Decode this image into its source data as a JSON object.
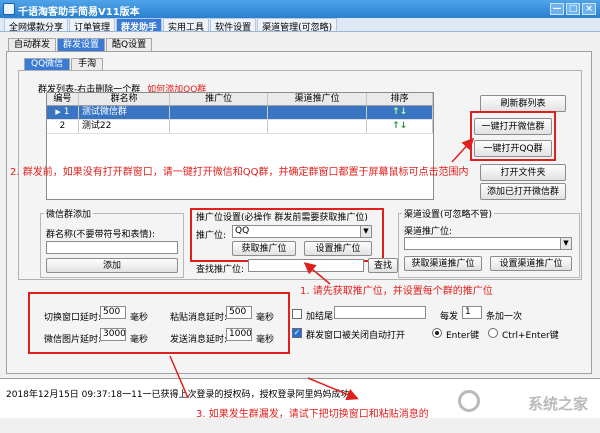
{
  "window": {
    "title": "千语淘客助手简易V11版本",
    "controls": [
      "—",
      "□",
      "×"
    ]
  },
  "menu_tabs": [
    "全网爆款分享",
    "订单管理",
    "群发助手",
    "实用工具",
    "软件设置",
    "渠道管理(可忽略)"
  ],
  "sub_tabs": [
    "自动群发",
    "群发设置",
    "酷Q设置"
  ],
  "sub_tabs2": [
    "QQ微信",
    "手淘"
  ],
  "group_list": {
    "title": "群发列表-右击删除一个群",
    "hint": "如何添加QQ群",
    "columns": [
      "编号",
      "群名称",
      "推广位",
      "渠道推广位",
      "排序"
    ],
    "rows": [
      {
        "marker": "▶",
        "num": "1",
        "name": "测试微信群",
        "pid": "",
        "channel": "",
        "sort": "↑↓"
      },
      {
        "marker": "",
        "num": "2",
        "name": "测试22",
        "pid": "",
        "channel": "",
        "sort": "↑↓"
      }
    ]
  },
  "buttons": {
    "refresh": "刷新群列表",
    "open_wechat": "一键打开微信群",
    "open_qq": "一键打开QQ群",
    "open_folder": "打开文件夹",
    "add_opened_wechat": "添加已打开微信群",
    "add": "添加",
    "get_pid": "获取推广位",
    "set_pid": "设置推广位",
    "search": "查找",
    "get_channel": "获取渠道推广位",
    "set_channel": "设置渠道推广位"
  },
  "wechat_add": {
    "title": "微信群添加",
    "label": "群名称(不要带符号和表情):",
    "value": ""
  },
  "pid_setting": {
    "title": "推广位设置(必操作 群发前需要获取推广位)",
    "label": "推广位:",
    "value": "QQ",
    "search_label": "查找推广位:",
    "search_value": ""
  },
  "channel_setting": {
    "title": "渠道设置(可忽略不管)",
    "label": "渠道推广位:",
    "value": ""
  },
  "delays": {
    "switch_label": "切换窗口延时:",
    "switch_value": "500",
    "paste_label": "粘贴消息延时:",
    "paste_value": "500",
    "image_label": "微信图片延时:",
    "image_value": "3000",
    "send_label": "发送消息延时:",
    "send_value": "1000",
    "unit": "毫秒"
  },
  "options": {
    "tail_label": "加结尾",
    "tail_checked": false,
    "tail_value": "",
    "every_label": "每发",
    "every_value": "1",
    "every_suffix": "条加一次",
    "autoclose_label": "群发窗口被关闭自动打开",
    "autoclose_checked": true,
    "enter_label": "Enter键",
    "ctrl_enter_label": "Ctrl+Enter键",
    "enter_selected": true
  },
  "status": {
    "log": "2018年12月15日  09:37:18一11一已获得上次登录的授权码，授权登录阿里妈妈成功!"
  },
  "annotations": {
    "a1": "1. 请先获取推广位，并设置每个群的推广位",
    "a2": "2. 群发前，如果没有打开群窗口，请一键打开微信和QQ群，并确定群窗口都置于屏幕鼠标可点击范围内",
    "a3": "3. 如果发生群漏发，请试下把切换窗口和粘贴消息的"
  },
  "watermark": "系统之家",
  "colors": {
    "accent": "#3a7bd5",
    "annotation": "#e0201c",
    "selected_row": "#3a75c4"
  }
}
